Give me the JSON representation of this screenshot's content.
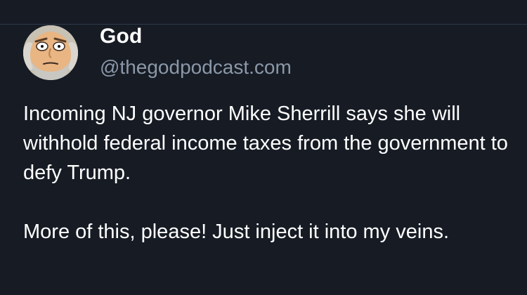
{
  "post": {
    "author": {
      "display_name": "God",
      "handle": "@thegodpodcast.com",
      "avatar_icon": "cartoon-old-man-avatar"
    },
    "paragraphs": [
      "Incoming NJ governor Mike Sherrill says she will withhold federal income taxes from the government to defy Trump.",
      "More of this, please! Just inject it into my veins."
    ]
  },
  "colors": {
    "background": "#161b24",
    "text": "#ffffff",
    "handle": "#8b98a8",
    "divider": "#2f3a4a"
  }
}
